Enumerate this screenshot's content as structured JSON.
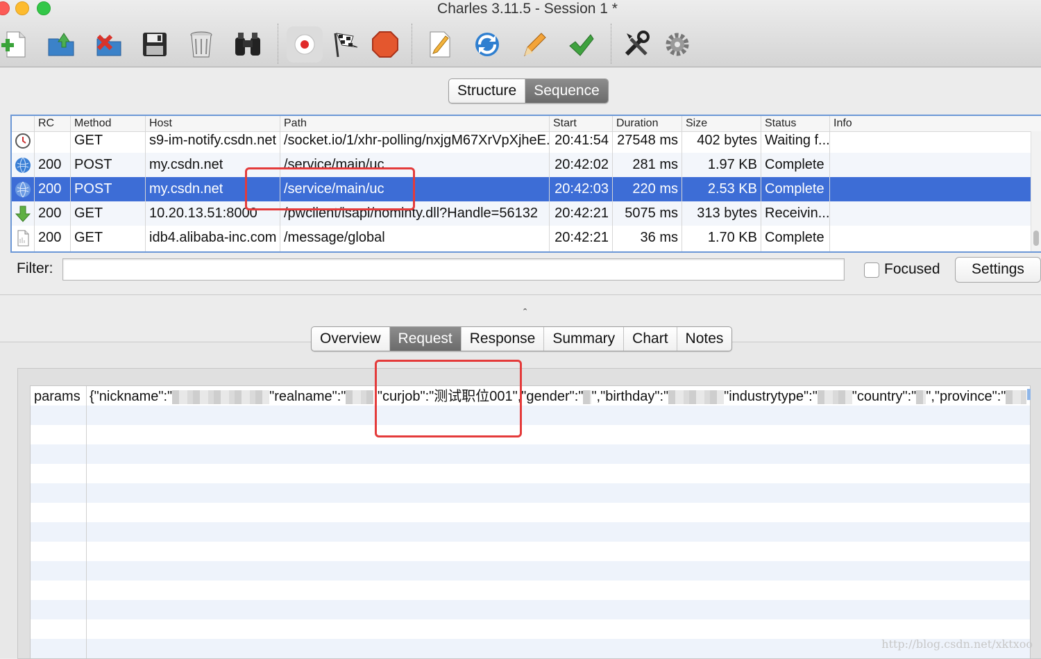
{
  "window": {
    "title": "Charles 3.11.5 - Session 1 *"
  },
  "toolbar": {
    "buttons": [
      {
        "name": "new-session"
      },
      {
        "name": "open"
      },
      {
        "name": "close"
      },
      {
        "name": "save"
      },
      {
        "name": "clear"
      },
      {
        "name": "find"
      },
      {
        "name": "record"
      },
      {
        "name": "throttle"
      },
      {
        "name": "breakpoints"
      },
      {
        "name": "compose"
      },
      {
        "name": "repeat"
      },
      {
        "name": "edit"
      },
      {
        "name": "validate"
      },
      {
        "name": "tools"
      },
      {
        "name": "settings"
      }
    ]
  },
  "view_tabs": {
    "structure": "Structure",
    "sequence": "Sequence",
    "active": "Sequence"
  },
  "table": {
    "columns": {
      "rc": "RC",
      "method": "Method",
      "host": "Host",
      "path": "Path",
      "start": "Start",
      "duration": "Duration",
      "size": "Size",
      "status": "Status",
      "info": "Info"
    },
    "rows": [
      {
        "icon": "clock-icon",
        "rc": "",
        "method": "GET",
        "host": "s9-im-notify.csdn.net",
        "path": "/socket.io/1/xhr-polling/nxjgM67XrVpXjheE...",
        "start": "20:41:54",
        "duration": "27548 ms",
        "size": "402 bytes",
        "status": "Waiting f...",
        "info": ""
      },
      {
        "icon": "globe-icon",
        "rc": "200",
        "method": "POST",
        "host": "my.csdn.net",
        "path": "/service/main/uc",
        "start": "20:42:02",
        "duration": "281 ms",
        "size": "1.97 KB",
        "status": "Complete",
        "info": ""
      },
      {
        "icon": "globe-icon",
        "rc": "200",
        "method": "POST",
        "host": "my.csdn.net",
        "path": "/service/main/uc",
        "start": "20:42:03",
        "duration": "220 ms",
        "size": "2.53 KB",
        "status": "Complete",
        "info": ""
      },
      {
        "icon": "download-arrow-icon",
        "rc": "200",
        "method": "GET",
        "host": "10.20.13.51:8000",
        "path": "/pwclient/isapi/nominty.dll?Handle=56132",
        "start": "20:42:21",
        "duration": "5075 ms",
        "size": "313 bytes",
        "status": "Receivin...",
        "info": ""
      },
      {
        "icon": "document-icon",
        "rc": "200",
        "method": "GET",
        "host": "idb4.alibaba-inc.com",
        "path": "/message/global",
        "start": "20:42:21",
        "duration": "36 ms",
        "size": "1.70 KB",
        "status": "Complete",
        "info": ""
      }
    ],
    "selected_row": 2
  },
  "filter": {
    "label": "Filter:",
    "value": "",
    "focused_label": "Focused",
    "focused_checked": false,
    "settings_label": "Settings"
  },
  "detail_tabs": {
    "items": [
      "Overview",
      "Request",
      "Response",
      "Summary",
      "Chart",
      "Notes"
    ],
    "active": "Request"
  },
  "request": {
    "key": "params",
    "value_prefix": "{\"nickname\":\"",
    "value_mid1": "\"realname\":\"",
    "value_highlight": ",\"curjob\":\"测试职位001\",",
    "value_mid2": "\"gender\":\"",
    "value_mid3": "\",\"birthday\":\"",
    "value_mid4": "\"industrytype\":\"",
    "value_mid5": "\"country\":\"",
    "value_mid6": "\",\"province\":\"",
    "value_end": "..."
  },
  "watermark": "http://blog.csdn.net/xktxoo",
  "colors": {
    "selection": "#3d6dd6",
    "annotation": "#e43b3b"
  }
}
